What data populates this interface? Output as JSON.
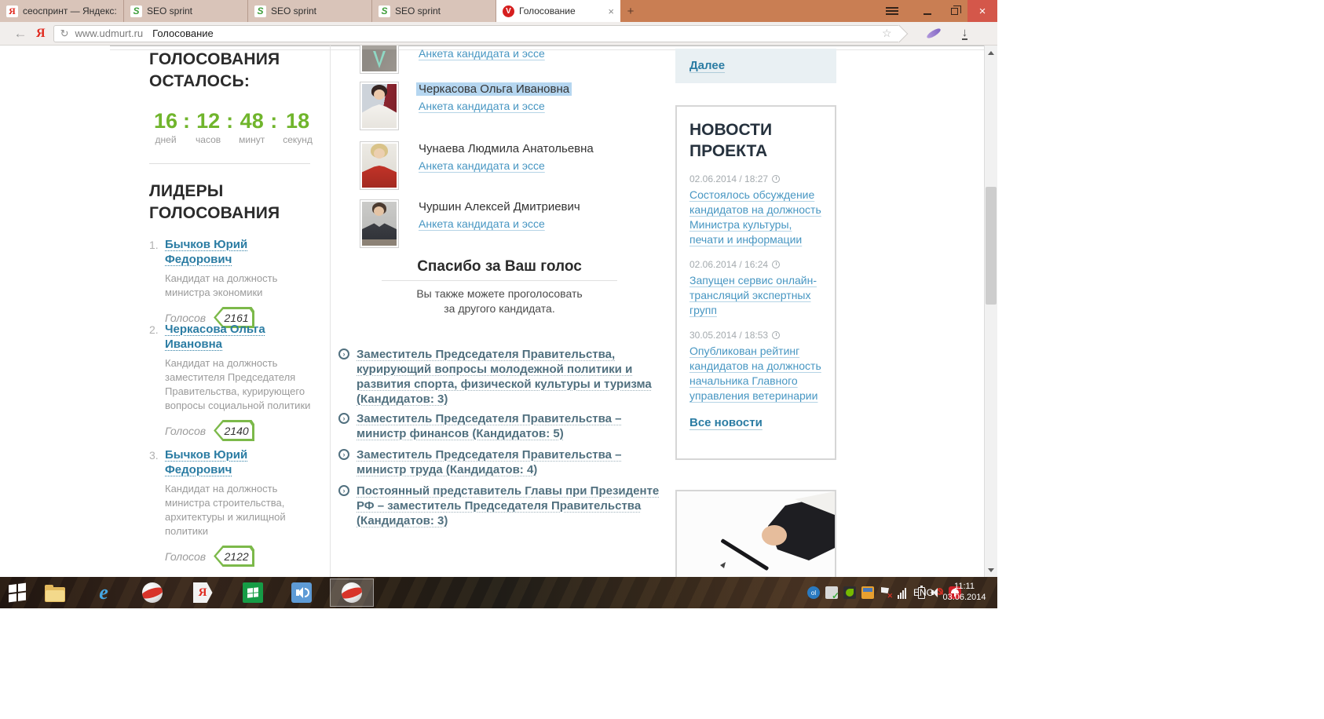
{
  "colors": {
    "accent_green": "#70b52c",
    "badge_border": "#7cb94a",
    "link_blue": "#4796c2",
    "leader_link": "#2b7ca3",
    "position_link": "#51707f",
    "tab_bar": "#c97e53",
    "close_button_red": "#d4574a",
    "selection_highlight": "#b5d6f0"
  },
  "browser": {
    "tabs": [
      {
        "label": "сеоспринт — Яндекс:",
        "icon": "yandex"
      },
      {
        "label": "SEO sprint",
        "icon": "seosprint"
      },
      {
        "label": "SEO sprint",
        "icon": "seosprint"
      },
      {
        "label": "SEO sprint",
        "icon": "seosprint"
      },
      {
        "label": "Голосование",
        "icon": "vote"
      }
    ],
    "active_tab_close": "×",
    "new_tab_label": "+",
    "window_close": "×",
    "back_arrow": "←",
    "yandex_letter": "Я",
    "reload_icon": "↻",
    "url": "www.udmurt.ru",
    "page_title": "Голосование",
    "bookmark_star": "☆",
    "download_arrow": "↓",
    "vote_icon_letter": "V",
    "seo_icon_letter": "S"
  },
  "sidebar_left": {
    "countdown_heading_line1": "ГОЛОСОВАНИЯ",
    "countdown_heading_line2": "ОСТАЛОСЬ:",
    "timer": {
      "days": "16",
      "hours": "12",
      "minutes": "48",
      "seconds": "18",
      "sep": ":",
      "labels": {
        "days": "дней",
        "hours": "часов",
        "minutes": "минут",
        "seconds": "секунд"
      }
    },
    "leaders_heading_line1": "ЛИДЕРЫ",
    "leaders_heading_line2": "ГОЛОСОВАНИЯ",
    "votes_label": "Голосов",
    "leaders": [
      {
        "num": "1.",
        "name": "Бычков Юрий Федорович",
        "desc": "Кандидат на должность министра экономики",
        "votes": "2161"
      },
      {
        "num": "2.",
        "name": "Черкасова Ольга Ивановна",
        "desc": "Кандидат на должность заместителя Председателя Правительства, курирующего вопросы социальной политики",
        "votes": "2140"
      },
      {
        "num": "3.",
        "name": "Бычков Юрий Федорович",
        "desc": "Кандидат на должность министра строительства, архитектуры и жилищной политики",
        "votes": "2122"
      }
    ]
  },
  "main": {
    "candidates": [
      {
        "name": "",
        "link": "Анкета кандидата и эссе"
      },
      {
        "name": "Черкасова Ольга Ивановна",
        "link": "Анкета кандидата и эссе"
      },
      {
        "name": "Чунаева Людмила Анатольевна",
        "link": "Анкета кандидата и эссе"
      },
      {
        "name": "Чуршин Алексей Дмитриевич",
        "link": "Анкета кандидата и эссе"
      }
    ],
    "thanks_title": "Спасибо за Ваш голос",
    "thanks_line1": "Вы также можете проголосовать",
    "thanks_line2": "за другого кандидата.",
    "positions": [
      {
        "text": "Заместитель Председателя Правительства, курирующий вопросы молодежной политики и развития спорта, физической культуры и туризма (Кандидатов: 3)"
      },
      {
        "text": "Заместитель Председателя Правительства – министр финансов (Кандидатов: 5)"
      },
      {
        "text": "Заместитель Председателя Правительства – министр труда (Кандидатов: 4)"
      },
      {
        "text": "Постоянный представитель Главы при Президенте РФ – заместитель Председателя Правительства (Кандидатов: 3)"
      }
    ],
    "position_arrow": "›"
  },
  "sidebar_right": {
    "next_link": "Далее",
    "news_title_line1": "НОВОСТИ",
    "news_title_line2": "ПРОЕКТА",
    "news": [
      {
        "date": "02.06.2014 / 18:27",
        "title": "Состоялось обсуждение кандидатов на должность Министра культуры, печати и информации"
      },
      {
        "date": "02.06.2014 / 16:24",
        "title": "Запущен сервис онлайн-трансляций экспертных групп"
      },
      {
        "date": "30.05.2014 / 18:53",
        "title": "Опубликован рейтинг кандидатов на должность начальника Главного управления ветеринарии"
      }
    ],
    "all_news": "Все новости"
  },
  "taskbar": {
    "lang": "ENG",
    "time": "11:11",
    "date": "03.06.2014"
  }
}
